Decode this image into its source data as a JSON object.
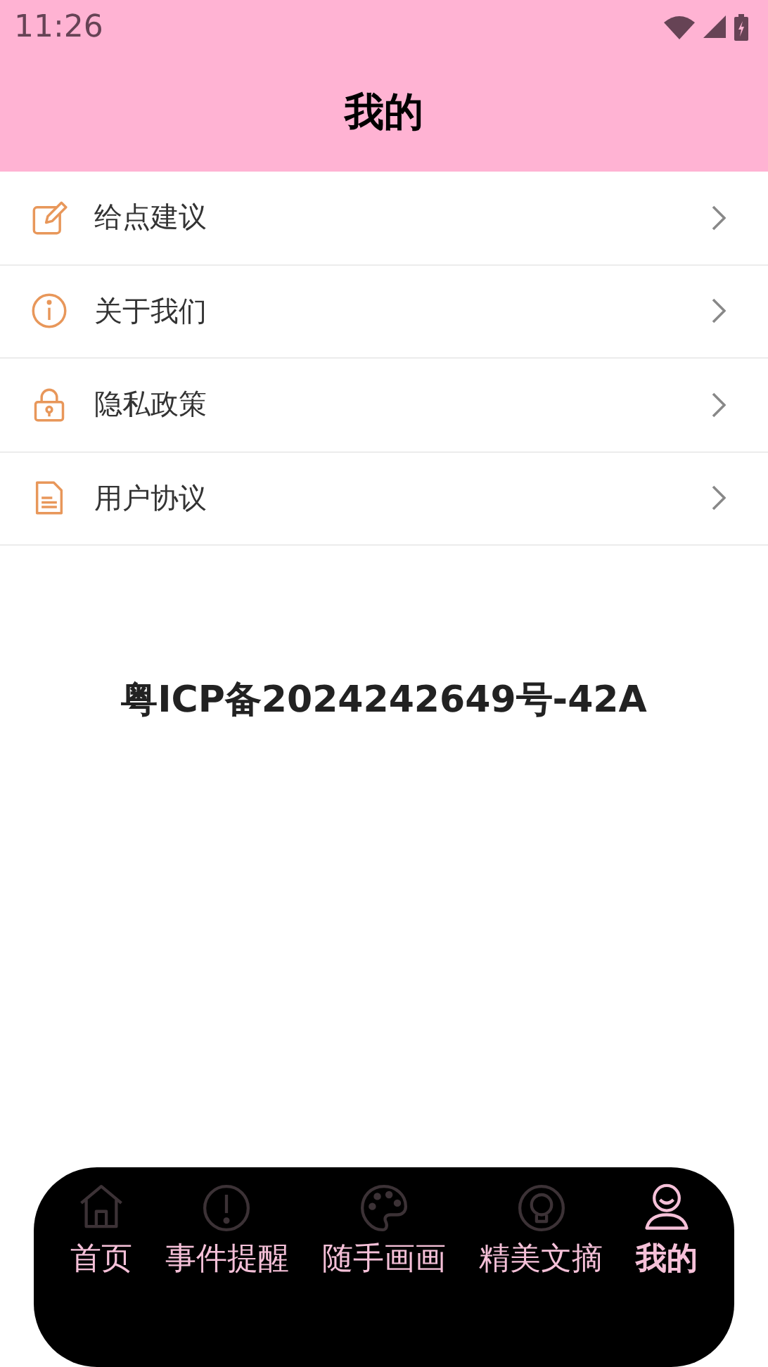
{
  "status_bar": {
    "time": "11:26"
  },
  "header": {
    "title": "我的"
  },
  "menu": [
    {
      "kind": "edit",
      "label": "给点建议"
    },
    {
      "kind": "info",
      "label": "关于我们"
    },
    {
      "kind": "lock",
      "label": "隐私政策"
    },
    {
      "kind": "doc",
      "label": "用户协议"
    }
  ],
  "license": "粤ICP备2024242649号-42A",
  "tabs": [
    {
      "kind": "home",
      "label": "首页",
      "selected": false
    },
    {
      "kind": "alert",
      "label": "事件提醒",
      "selected": false
    },
    {
      "kind": "palette",
      "label": "随手画画",
      "selected": false
    },
    {
      "kind": "bulb",
      "label": "精美文摘",
      "selected": false
    },
    {
      "kind": "person",
      "label": "我的",
      "selected": true
    }
  ]
}
